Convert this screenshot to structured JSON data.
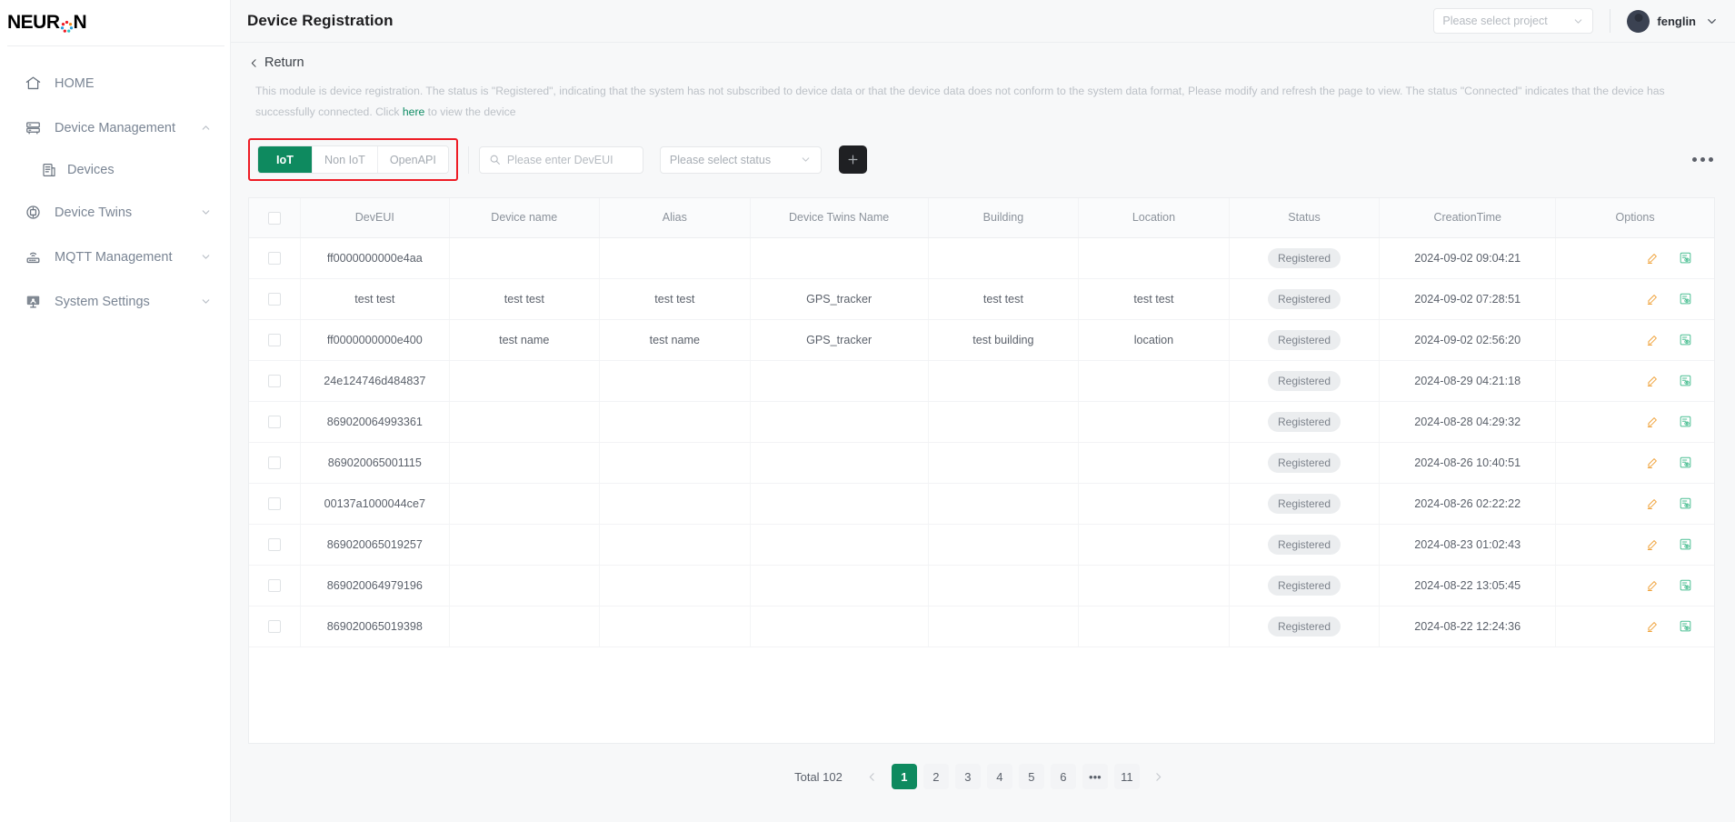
{
  "sidebar": {
    "logo": "NEUR",
    "logo_suffix": "N",
    "items": [
      {
        "label": "HOME",
        "icon": "home-icon",
        "chevron": ""
      },
      {
        "label": "Device Management",
        "icon": "server-icon",
        "chevron": "up"
      },
      {
        "label": "Devices",
        "icon": "device-icon",
        "chevron": ""
      },
      {
        "label": "Device Twins",
        "icon": "twins-icon",
        "chevron": "down"
      },
      {
        "label": "MQTT Management",
        "icon": "mqtt-icon",
        "chevron": "down"
      },
      {
        "label": "System Settings",
        "icon": "settings-icon",
        "chevron": "down"
      }
    ]
  },
  "header": {
    "title": "Device Registration",
    "project_select_placeholder": "Please select project",
    "username": "fenglin"
  },
  "page": {
    "return_label": "Return",
    "description_part1": "This module is device registration. The status is \"Registered\", indicating that the system has not subscribed to device data or that the device data does not conform to the system data format, Please modify and refresh the page to view. The status \"Connected\" indicates that the device has successfully connected. Click ",
    "description_link": "here",
    "description_part2": " to view the device"
  },
  "toolbar": {
    "tabs": [
      {
        "label": "IoT",
        "active": true
      },
      {
        "label": "Non IoT",
        "active": false
      },
      {
        "label": "OpenAPI",
        "active": false
      }
    ],
    "search_placeholder": "Please enter DevEUI",
    "search_value": "",
    "status_placeholder": "Please select status",
    "add_label": "+",
    "more_label": "more-options"
  },
  "table": {
    "columns": [
      "",
      "DevEUI",
      "Device name",
      "Alias",
      "Device Twins Name",
      "Building",
      "Location",
      "Status",
      "CreationTime",
      "Options"
    ],
    "rows": [
      {
        "deveui": "ff0000000000e4aa",
        "device_name": "",
        "alias": "",
        "twins": "",
        "building": "",
        "location": "",
        "status": "Registered",
        "created": "2024-09-02 09:04:21"
      },
      {
        "deveui": "test test",
        "device_name": "test test",
        "alias": "test test",
        "twins": "GPS_tracker",
        "building": "test test",
        "location": "test test",
        "status": "Registered",
        "created": "2024-09-02 07:28:51"
      },
      {
        "deveui": "ff0000000000e400",
        "device_name": "test name",
        "alias": "test name",
        "twins": "GPS_tracker",
        "building": "test building",
        "location": "location",
        "status": "Registered",
        "created": "2024-09-02 02:56:20"
      },
      {
        "deveui": "24e124746d484837",
        "device_name": "",
        "alias": "",
        "twins": "",
        "building": "",
        "location": "",
        "status": "Registered",
        "created": "2024-08-29 04:21:18"
      },
      {
        "deveui": "869020064993361",
        "device_name": "",
        "alias": "",
        "twins": "",
        "building": "",
        "location": "",
        "status": "Registered",
        "created": "2024-08-28 04:29:32"
      },
      {
        "deveui": "869020065001115",
        "device_name": "",
        "alias": "",
        "twins": "",
        "building": "",
        "location": "",
        "status": "Registered",
        "created": "2024-08-26 10:40:51"
      },
      {
        "deveui": "00137a1000044ce7",
        "device_name": "",
        "alias": "",
        "twins": "",
        "building": "",
        "location": "",
        "status": "Registered",
        "created": "2024-08-26 02:22:22"
      },
      {
        "deveui": "869020065019257",
        "device_name": "",
        "alias": "",
        "twins": "",
        "building": "",
        "location": "",
        "status": "Registered",
        "created": "2024-08-23 01:02:43"
      },
      {
        "deveui": "869020064979196",
        "device_name": "",
        "alias": "",
        "twins": "",
        "building": "",
        "location": "",
        "status": "Registered",
        "created": "2024-08-22 13:05:45"
      },
      {
        "deveui": "869020065019398",
        "device_name": "",
        "alias": "",
        "twins": "",
        "building": "",
        "location": "",
        "status": "Registered",
        "created": "2024-08-22 12:24:36"
      }
    ]
  },
  "pagination": {
    "total_label": "Total 102",
    "prev": "‹",
    "next": "›",
    "pages": [
      "1",
      "2",
      "3",
      "4",
      "5",
      "6",
      "•••",
      "11"
    ],
    "current": "1"
  },
  "colors": {
    "accent_green": "#0e8a5f",
    "highlight_red": "#ee1c25",
    "link_green": "#0d8b63",
    "edit_icon": "#f0a33c",
    "view_icon": "#4cbf93"
  }
}
